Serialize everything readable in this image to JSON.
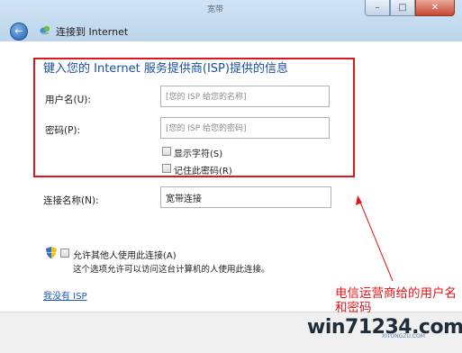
{
  "window": {
    "title": "连接到 Internet",
    "wintitle_ghost": "宽带",
    "controls": {
      "minimize": "–",
      "maximize": "□",
      "close": "✕"
    }
  },
  "heading": "键入您的 Internet 服务提供商(ISP)提供的信息",
  "form": {
    "username_label": "用户名(U):",
    "username_placeholder": "[您的 ISP 给您的名称]",
    "password_label": "密码(P):",
    "password_placeholder": "[您的 ISP 给您的密码]",
    "show_chars_label": "显示字符(S)",
    "remember_label": "记住此密码(R)",
    "connection_name_label": "连接名称(N):",
    "connection_name_value": "宽带连接",
    "allow_others_label": "允许其他人使用此连接(A)",
    "allow_others_desc": "这个选项允许可以访问这台计算机的人使用此连接。"
  },
  "no_isp_link": "我没有 ISP",
  "annotation": "电信运营商给的用户名和密码",
  "watermark": {
    "logo": "win71234.com",
    "url": "XITONGZU.COM"
  },
  "colors": {
    "annotation_red": "#e0161a",
    "heading_blue": "#1b4fa0",
    "link_blue": "#1c5db4"
  }
}
